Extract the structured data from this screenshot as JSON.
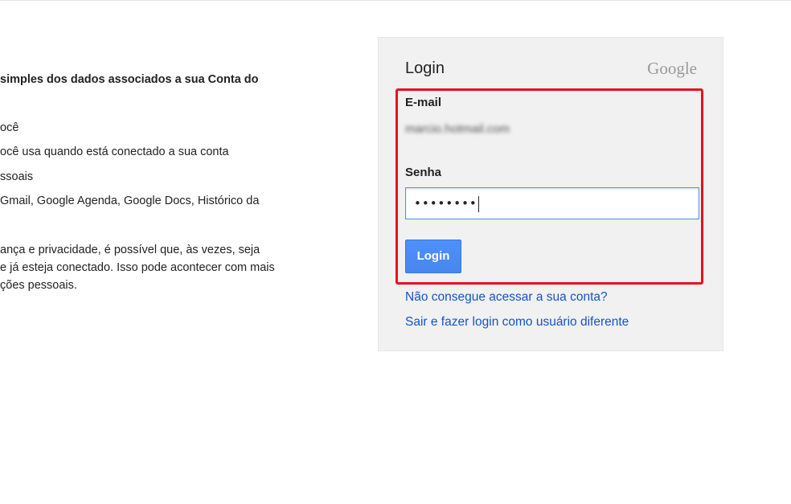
{
  "left_text": {
    "heading": "simples dos dados associados a sua Conta do",
    "items": [
      "ocê",
      "ocê usa quando está conectado a sua conta",
      "ssoais",
      "Gmail, Google Agenda, Google Docs, Histórico da"
    ],
    "paragraph": [
      "ança e privacidade, é possível que, às vezes, seja",
      "e já esteja conectado. Isso pode acontecer com mais",
      "ções pessoais."
    ]
  },
  "login": {
    "title": "Login",
    "logo": "Google",
    "email_label": "E-mail",
    "email_value": "marcio.hotmail.com",
    "password_label": "Senha",
    "password_value": "••••••••",
    "button_label": "Login",
    "links": {
      "cant_access": "Não consegue acessar a sua conta?",
      "switch_user": "Sair e fazer login como usuário diferente"
    }
  },
  "colors": {
    "highlight": "#e8101d",
    "button": "#4d90fe",
    "link": "#1155cc"
  }
}
